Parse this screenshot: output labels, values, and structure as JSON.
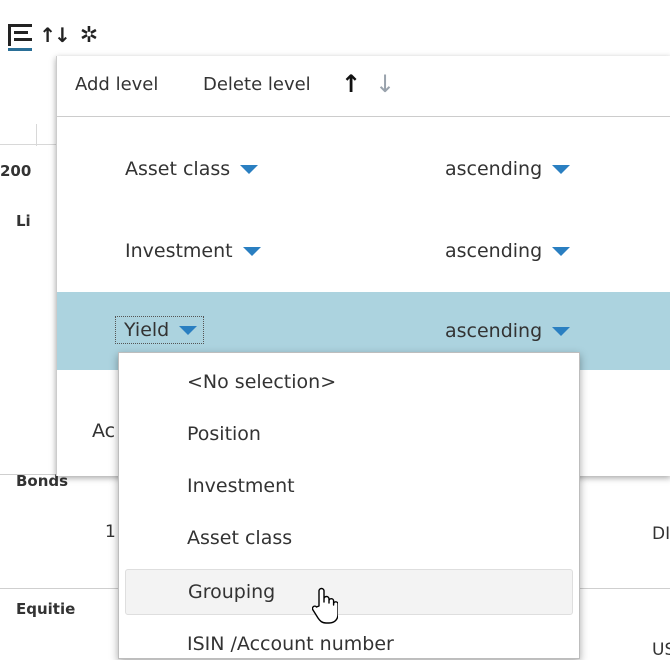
{
  "toolbar": {
    "icons": [
      "tree-view-icon",
      "sort-icon",
      "gear-icon"
    ],
    "sort_glyph": "↑↓",
    "gear_glyph": "✲"
  },
  "background": {
    "year_fragment": "200",
    "row1_label": "Li",
    "bonds_label": "Bonds",
    "bonds_num": "1",
    "bonds_right": "DI",
    "equities_label": "Equitie",
    "equities_right": "US"
  },
  "sort_panel": {
    "add_level": "Add level",
    "delete_level": "Delete level",
    "move_up_glyph": "↑",
    "move_down_glyph": "↓",
    "levels": [
      {
        "field": "Asset class",
        "order": "ascending",
        "selected": false
      },
      {
        "field": "Investment",
        "order": "ascending",
        "selected": false
      },
      {
        "field": "Yield",
        "order": "ascending",
        "selected": true
      }
    ],
    "add_fragment": "Ac"
  },
  "dropdown": {
    "options": [
      "<No selection>",
      "Position",
      "Investment",
      "Asset class",
      "Grouping",
      "ISIN /Account number"
    ],
    "hovered": "Grouping"
  },
  "colors": {
    "accent": "#2a7fc1",
    "selected_row": "#acd3df",
    "tree_underline": "#2a6f97"
  }
}
